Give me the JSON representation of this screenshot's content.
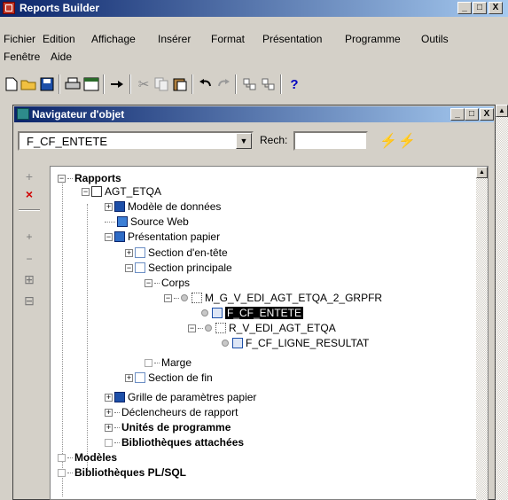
{
  "app": {
    "title": "Reports Builder"
  },
  "window_buttons": {
    "minimize": "_",
    "maximize": "□",
    "close": "X"
  },
  "menu": {
    "items": [
      "Fichier",
      "Edition",
      "Affichage",
      "Insérer",
      "Format",
      "Présentation",
      "Programme",
      "Outils",
      "Fenêtre",
      "Aide"
    ]
  },
  "toolbar": {
    "icons": [
      "new-file-icon",
      "open-folder-icon",
      "save-icon",
      "print-icon",
      "print-preview-icon",
      "run-icon",
      "cut-icon",
      "copy-icon",
      "paste-icon",
      "undo-icon",
      "redo-icon",
      "expand-tree-icon",
      "collapse-tree-icon",
      "help-icon"
    ],
    "help_glyph": "?"
  },
  "navigator": {
    "title": "Navigateur d'objet",
    "combo_value": "F_CF_ENTETE",
    "search_label": "Rech:",
    "search_value": "",
    "tools": [
      "+",
      "×",
      "+",
      "−",
      "⊞",
      "⊟"
    ]
  },
  "tree": [
    {
      "label": "Rapports",
      "bold": true
    },
    {
      "label": "AGT_ETQA"
    },
    {
      "label": "Modèle de données"
    },
    {
      "label": "Source Web"
    },
    {
      "label": "Présentation papier"
    },
    {
      "label": "Section d'en-tête"
    },
    {
      "label": "Section principale"
    },
    {
      "label": "Corps"
    },
    {
      "label": "M_G_V_EDI_AGT_ETQA_2_GRPFR"
    },
    {
      "label": "F_CF_ENTETE",
      "selected": true
    },
    {
      "label": "R_V_EDI_AGT_ETQA"
    },
    {
      "label": "F_CF_LIGNE_RESULTAT"
    },
    {
      "label": "Marge"
    },
    {
      "label": "Section de fin"
    },
    {
      "label": "Grille de paramètres papier"
    },
    {
      "label": "Déclencheurs de rapport"
    },
    {
      "label": "Unités de programme",
      "bold": true
    },
    {
      "label": "Bibliothèques attachées",
      "bold": true
    },
    {
      "label": "Modèles",
      "bold": true
    },
    {
      "label": "Bibliothèques PL/SQL",
      "bold": true
    }
  ]
}
